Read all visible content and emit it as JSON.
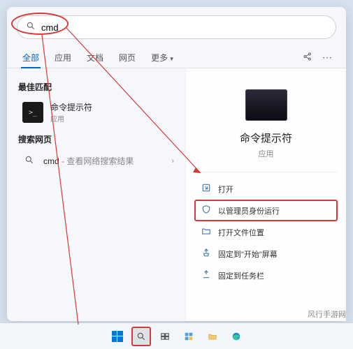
{
  "search": {
    "value": "cmd",
    "placeholder": ""
  },
  "tabs": {
    "items": [
      "全部",
      "应用",
      "文档",
      "网页",
      "更多"
    ],
    "active_index": 0
  },
  "left": {
    "best_match_heading": "最佳匹配",
    "best_match": {
      "name": "命令提示符",
      "type": "应用"
    },
    "web_heading": "搜索网页",
    "web_items": [
      {
        "icon_label": "search-icon",
        "prefix": "cmd",
        "suffix": " - 查看网络搜索结果"
      }
    ]
  },
  "preview": {
    "title": "命令提示符",
    "subtitle": "应用",
    "actions": [
      {
        "icon": "open-icon",
        "label": "打开",
        "highlighted": false
      },
      {
        "icon": "admin-icon",
        "label": "以管理员身份运行",
        "highlighted": true
      },
      {
        "icon": "folder-icon",
        "label": "打开文件位置",
        "highlighted": false
      },
      {
        "icon": "pin-start-icon",
        "label": "固定到\"开始\"屏幕",
        "highlighted": false
      },
      {
        "icon": "pin-taskbar-icon",
        "label": "固定到任务栏",
        "highlighted": false
      }
    ]
  },
  "watermark": "风行手游网",
  "taskbar": {
    "items": [
      {
        "name": "start-button",
        "kind": "windows"
      },
      {
        "name": "search-button",
        "kind": "search",
        "outlined": true
      },
      {
        "name": "task-view-button",
        "kind": "taskview"
      },
      {
        "name": "widgets-button",
        "kind": "widgets"
      },
      {
        "name": "explorer-button",
        "kind": "explorer"
      },
      {
        "name": "edge-button",
        "kind": "edge"
      }
    ]
  }
}
